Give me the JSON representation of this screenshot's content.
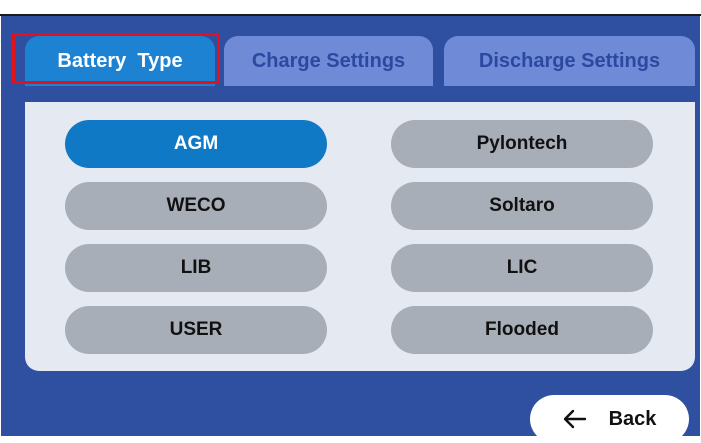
{
  "tabs": {
    "battery_type": "Battery  Type",
    "charge_settings": "Charge Settings",
    "discharge_settings": "Discharge Settings"
  },
  "battery_options": {
    "left": [
      "AGM",
      "WECO",
      "LIB",
      "USER"
    ],
    "right": [
      "Pylontech",
      "Soltaro",
      "LIC",
      "Flooded"
    ],
    "selected": "AGM"
  },
  "footer": {
    "back_label": "Back",
    "back_icon": "arrow-left-icon"
  },
  "colors": {
    "screen_bg": "#2f4fa0",
    "tab_active": "#1d82d1",
    "tab_inactive": "#6f8ad6",
    "option_selected": "#0f79c6",
    "option_default": "#a8aeb7",
    "highlight_box": "#e0121c"
  }
}
